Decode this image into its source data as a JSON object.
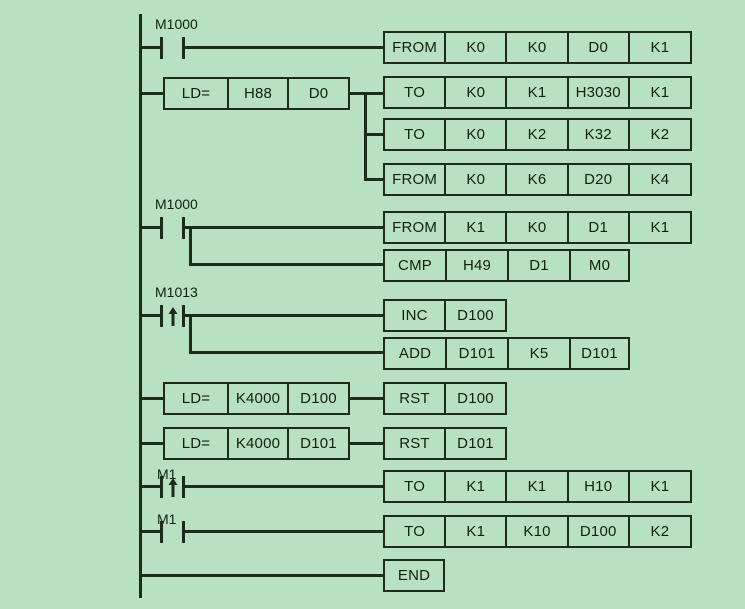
{
  "diagram": {
    "title": "PLC Ladder Logic Program",
    "background_color": "#b8e0c2",
    "line_color": "#1c2b1c",
    "text_color": "#102010"
  },
  "rungs": [
    {
      "id": "rung-1",
      "contact": {
        "label": "M1000",
        "type": "normally-open"
      },
      "blocks": [
        {
          "name": "from-k0-k0-d0-k1",
          "cells": [
            "FROM",
            "K0",
            "K0",
            "D0",
            "K1"
          ]
        }
      ]
    },
    {
      "id": "rung-2",
      "compare": {
        "name": "ld-equal-h88-d0",
        "cells": [
          "LD=",
          "H88",
          "D0"
        ]
      },
      "blocks": [
        {
          "name": "to-k0-k1-h3030-k1",
          "cells": [
            "TO",
            "K0",
            "K1",
            "H3030",
            "K1"
          ]
        },
        {
          "name": "to-k0-k2-k32-k2",
          "cells": [
            "TO",
            "K0",
            "K2",
            "K32",
            "K2"
          ]
        },
        {
          "name": "from-k0-k6-d20-k4",
          "cells": [
            "FROM",
            "K0",
            "K6",
            "D20",
            "K4"
          ]
        }
      ]
    },
    {
      "id": "rung-3",
      "contact": {
        "label": "M1000",
        "type": "normally-open"
      },
      "blocks": [
        {
          "name": "from-k1-k0-d1-k1",
          "cells": [
            "FROM",
            "K1",
            "K0",
            "D1",
            "K1"
          ]
        },
        {
          "name": "cmp-h49-d1-m0",
          "cells": [
            "CMP",
            "H49",
            "D1",
            "M0"
          ]
        }
      ]
    },
    {
      "id": "rung-4",
      "contact": {
        "label": "M1013",
        "type": "rising-edge"
      },
      "blocks": [
        {
          "name": "inc-d100",
          "cells": [
            "INC",
            "D100"
          ]
        },
        {
          "name": "add-d101-k5-d101",
          "cells": [
            "ADD",
            "D101",
            "K5",
            "D101"
          ]
        }
      ]
    },
    {
      "id": "rung-5",
      "compare": {
        "name": "ld-equal-k4000-d100",
        "cells": [
          "LD=",
          "K4000",
          "D100"
        ]
      },
      "blocks": [
        {
          "name": "rst-d100",
          "cells": [
            "RST",
            "D100"
          ]
        }
      ]
    },
    {
      "id": "rung-6",
      "compare": {
        "name": "ld-equal-k4000-d101",
        "cells": [
          "LD=",
          "K4000",
          "D101"
        ]
      },
      "blocks": [
        {
          "name": "rst-d101",
          "cells": [
            "RST",
            "D101"
          ]
        }
      ]
    },
    {
      "id": "rung-7",
      "contact": {
        "label": "M1",
        "type": "rising-edge"
      },
      "blocks": [
        {
          "name": "to-k1-k1-h10-k1",
          "cells": [
            "TO",
            "K1",
            "K1",
            "H10",
            "K1"
          ]
        }
      ]
    },
    {
      "id": "rung-8",
      "contact": {
        "label": "M1",
        "type": "normally-open"
      },
      "blocks": [
        {
          "name": "to-k1-k10-d100-k2",
          "cells": [
            "TO",
            "K1",
            "K10",
            "D100",
            "K2"
          ]
        }
      ]
    },
    {
      "id": "rung-9",
      "blocks": [
        {
          "name": "end-instruction",
          "cells": [
            "END"
          ]
        }
      ]
    }
  ],
  "labels": {
    "m1000_a": "M1000",
    "m1000_b": "M1000",
    "m1013": "M1013",
    "m1_a": "M1",
    "m1_b": "M1"
  },
  "boxes": {
    "b1": [
      "FROM",
      "K0",
      "K0",
      "D0",
      "K1"
    ],
    "b2": [
      "LD=",
      "H88",
      "D0"
    ],
    "b3": [
      "TO",
      "K0",
      "K1",
      "H3030",
      "K1"
    ],
    "b4": [
      "TO",
      "K0",
      "K2",
      "K32",
      "K2"
    ],
    "b5": [
      "FROM",
      "K0",
      "K6",
      "D20",
      "K4"
    ],
    "b6": [
      "FROM",
      "K1",
      "K0",
      "D1",
      "K1"
    ],
    "b7": [
      "CMP",
      "H49",
      "D1",
      "M0"
    ],
    "b8": [
      "INC",
      "D100"
    ],
    "b9": [
      "ADD",
      "D101",
      "K5",
      "D101"
    ],
    "b10": [
      "LD=",
      "K4000",
      "D100"
    ],
    "b11": [
      "RST",
      "D100"
    ],
    "b12": [
      "LD=",
      "K4000",
      "D101"
    ],
    "b13": [
      "RST",
      "D101"
    ],
    "b14": [
      "TO",
      "K1",
      "K1",
      "H10",
      "K1"
    ],
    "b15": [
      "TO",
      "K1",
      "K10",
      "D100",
      "K2"
    ],
    "b16": [
      "END"
    ]
  }
}
